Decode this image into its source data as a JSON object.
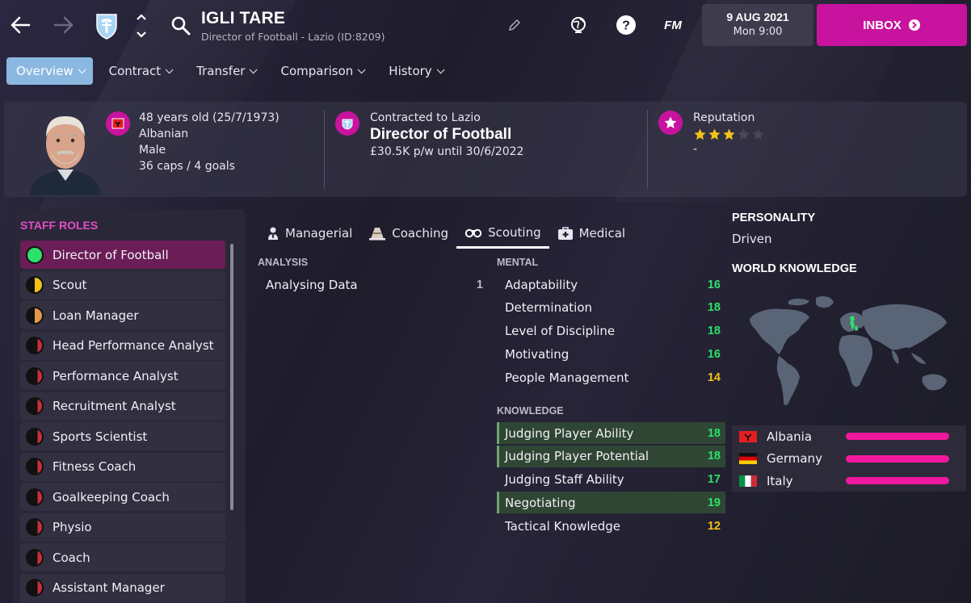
{
  "header": {
    "title": "IGLI TARE",
    "subtitle": "Director of Football - Lazio (ID:8209)",
    "date": "9 AUG 2021",
    "time": "Mon 9:00",
    "inbox_label": "INBOX",
    "fm_label": "FM",
    "accent_color": "#c8139e"
  },
  "subnav": {
    "items": [
      {
        "label": "Overview",
        "active": true
      },
      {
        "label": "Contract",
        "active": false
      },
      {
        "label": "Transfer",
        "active": false
      },
      {
        "label": "Comparison",
        "active": false
      },
      {
        "label": "History",
        "active": false
      }
    ]
  },
  "profile": {
    "age_line": "48 years old (25/7/1973)",
    "nationality": "Albanian",
    "gender": "Male",
    "caps": "36 caps / 4 goals",
    "contract_line": "Contracted to Lazio",
    "role": "Director of Football",
    "wage_line": "£30.5K p/w until 30/6/2022",
    "reputation_label": "Reputation",
    "reputation_stars": 3,
    "reputation_max": 5,
    "reputation_value": "-"
  },
  "staff_roles": {
    "title": "STAFF ROLES",
    "items": [
      {
        "label": "Director of Football",
        "suitability": "full",
        "active": true
      },
      {
        "label": "Scout",
        "suitability": "half-yellow",
        "active": false
      },
      {
        "label": "Loan Manager",
        "suitability": "half-orange",
        "active": false
      },
      {
        "label": "Head Performance Analyst",
        "suitability": "low",
        "active": false
      },
      {
        "label": "Performance Analyst",
        "suitability": "low",
        "active": false
      },
      {
        "label": "Recruitment Analyst",
        "suitability": "low",
        "active": false
      },
      {
        "label": "Sports Scientist",
        "suitability": "low",
        "active": false
      },
      {
        "label": "Fitness Coach",
        "suitability": "low",
        "active": false
      },
      {
        "label": "Goalkeeping Coach",
        "suitability": "low",
        "active": false
      },
      {
        "label": "Physio",
        "suitability": "low",
        "active": false
      },
      {
        "label": "Coach",
        "suitability": "low",
        "active": false
      },
      {
        "label": "Assistant Manager",
        "suitability": "low",
        "active": false
      }
    ]
  },
  "attribute_tabs": [
    {
      "label": "Managerial",
      "icon": "manager-icon",
      "active": false
    },
    {
      "label": "Coaching",
      "icon": "coaching-cone-icon",
      "active": false
    },
    {
      "label": "Scouting",
      "icon": "binoculars-icon",
      "active": true
    },
    {
      "label": "Medical",
      "icon": "medical-kit-icon",
      "active": false
    }
  ],
  "analysis": {
    "heading": "ANALYSIS",
    "rows": [
      {
        "label": "Analysing Data",
        "value": "1"
      }
    ]
  },
  "mental": {
    "heading": "MENTAL",
    "rows": [
      {
        "label": "Adaptability",
        "value": "16"
      },
      {
        "label": "Determination",
        "value": "18"
      },
      {
        "label": "Level of Discipline",
        "value": "18"
      },
      {
        "label": "Motivating",
        "value": "16"
      },
      {
        "label": "People Management",
        "value": "14"
      }
    ]
  },
  "knowledge": {
    "heading": "KNOWLEDGE",
    "rows": [
      {
        "label": "Judging Player Ability",
        "value": "18",
        "highlight": true
      },
      {
        "label": "Judging Player Potential",
        "value": "18",
        "highlight": true
      },
      {
        "label": "Judging Staff Ability",
        "value": "17",
        "highlight": false
      },
      {
        "label": "Negotiating",
        "value": "19",
        "highlight": true
      },
      {
        "label": "Tactical Knowledge",
        "value": "12",
        "highlight": false
      }
    ]
  },
  "colors": {
    "value_green": "#2ee06a",
    "value_yellow": "#f2c21b",
    "value_grey": "#bdb9c9",
    "knowledge_bar": "#f0189e"
  },
  "personality": {
    "heading": "PERSONALITY",
    "value": "Driven"
  },
  "world_knowledge": {
    "heading": "WORLD KNOWLEDGE",
    "countries": [
      {
        "name": "Albania",
        "flag": "albania-flag",
        "level": 1.0
      },
      {
        "name": "Germany",
        "flag": "germany-flag",
        "level": 1.0
      },
      {
        "name": "Italy",
        "flag": "italy-flag",
        "level": 1.0
      }
    ]
  }
}
